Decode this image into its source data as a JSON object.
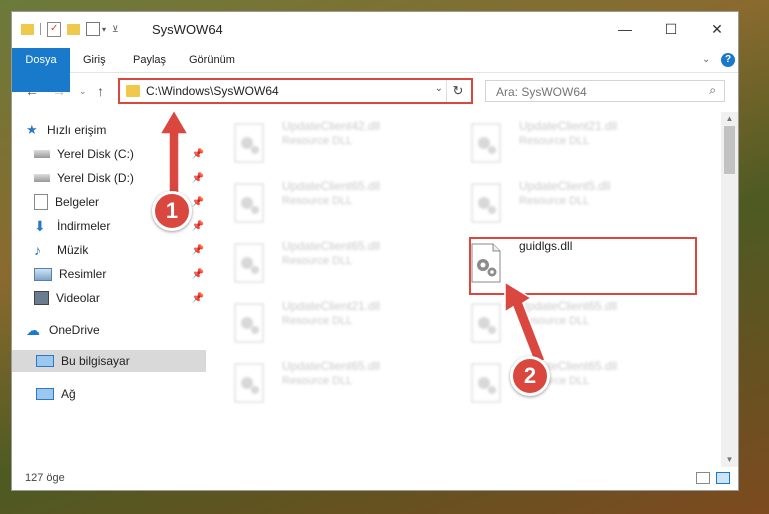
{
  "window": {
    "title": "SysWOW64",
    "controls": {
      "minimize": "—",
      "maximize": "☐",
      "close": "✕"
    }
  },
  "ribbon": {
    "tabs": [
      "Dosya",
      "Giriş",
      "Paylaş",
      "Görünüm"
    ],
    "expand_icon": "chevron-down-icon",
    "help_icon": "?"
  },
  "address_bar": {
    "path": "C:\\Windows\\SysWOW64"
  },
  "search": {
    "placeholder": "Ara: SysWOW64"
  },
  "sidebar": {
    "items": [
      {
        "label": "Hızlı erişim",
        "icon": "star-icon",
        "pinned": false
      },
      {
        "label": "Yerel Disk (C:)",
        "icon": "drive-icon",
        "pinned": true
      },
      {
        "label": "Yerel Disk (D:)",
        "icon": "drive-icon",
        "pinned": true
      },
      {
        "label": "Belgeler",
        "icon": "document-icon",
        "pinned": true
      },
      {
        "label": "İndirmeler",
        "icon": "download-icon",
        "pinned": true
      },
      {
        "label": "Müzik",
        "icon": "music-icon",
        "pinned": true
      },
      {
        "label": "Resimler",
        "icon": "pictures-icon",
        "pinned": true
      },
      {
        "label": "Videolar",
        "icon": "video-icon",
        "pinned": true
      },
      {
        "label": "OneDrive",
        "icon": "cloud-icon",
        "pinned": false
      },
      {
        "label": "Bu bilgisayar",
        "icon": "computer-icon",
        "pinned": false,
        "selected": true
      },
      {
        "label": "Ağ",
        "icon": "network-icon",
        "pinned": false
      }
    ]
  },
  "files": [
    {
      "name": "UpdateClient42.dll",
      "desc": "Resource DLL",
      "faded": true
    },
    {
      "name": "UpdateClient21.dll",
      "desc": "Resource DLL",
      "faded": true
    },
    {
      "name": "UpdateClient65.dll",
      "desc": "Resource DLL",
      "faded": true
    },
    {
      "name": "UpdateClient5.dll",
      "desc": "Resource DLL",
      "faded": true
    },
    {
      "name": "UpdateClient65.dll",
      "desc": "Resource DLL",
      "faded": true
    },
    {
      "name": "guidlgs.dll",
      "desc": "",
      "faded": false
    },
    {
      "name": "UpdateClient21.dll",
      "desc": "Resource DLL",
      "faded": true
    },
    {
      "name": "UpdateClient65.dll",
      "desc": "Resource DLL",
      "faded": true
    },
    {
      "name": "UpdateClient65.dll",
      "desc": "Resource DLL",
      "faded": true
    },
    {
      "name": "UpdateClient65.dll",
      "desc": "Resource DLL",
      "faded": true
    }
  ],
  "status": {
    "item_count": "127 öge"
  },
  "callouts": [
    "1",
    "2"
  ],
  "colors": {
    "accent": "#1979ca",
    "highlight": "#d9473f",
    "selected_bg": "#d9d9d9"
  }
}
